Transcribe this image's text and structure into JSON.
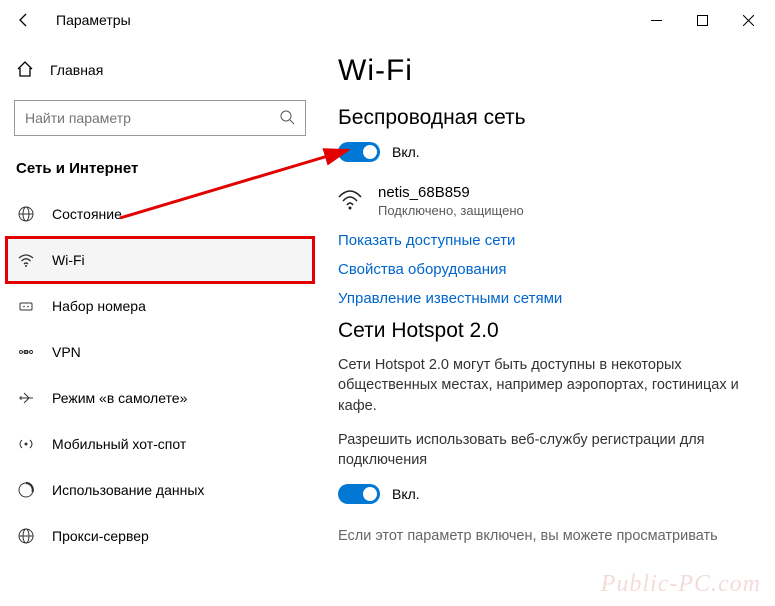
{
  "titlebar": {
    "title": "Параметры"
  },
  "sidebar": {
    "home": "Главная",
    "search_placeholder": "Найти параметр",
    "section": "Сеть и Интернет",
    "items": [
      {
        "label": "Состояние",
        "icon": "globe"
      },
      {
        "label": "Wi-Fi",
        "icon": "wifi",
        "selected": true
      },
      {
        "label": "Набор номера",
        "icon": "dialup"
      },
      {
        "label": "VPN",
        "icon": "vpn"
      },
      {
        "label": "Режим «в самолете»",
        "icon": "airplane"
      },
      {
        "label": "Мобильный хот-спот",
        "icon": "hotspot"
      },
      {
        "label": "Использование данных",
        "icon": "datausage"
      },
      {
        "label": "Прокси-сервер",
        "icon": "proxy"
      }
    ]
  },
  "content": {
    "heading": "Wi-Fi",
    "wireless_subheading": "Беспроводная сеть",
    "toggle1_label": "Вкл.",
    "network": {
      "name": "netis_68B859",
      "status": "Подключено, защищено"
    },
    "links": {
      "show_networks": "Показать доступные сети",
      "hardware_props": "Свойства оборудования",
      "manage_known": "Управление известными сетями"
    },
    "hotspot_subheading": "Сети Hotspot 2.0",
    "hotspot_desc": "Сети Hotspot 2.0 могут быть доступны в некоторых общественных местах, например аэропортах, гостиницах и кафе.",
    "permit_label": "Разрешить использовать веб-службу регистрации для подключения",
    "toggle2_label": "Вкл.",
    "tail": "Если этот параметр включен, вы можете просматривать"
  },
  "watermark": "Public-PC.com"
}
